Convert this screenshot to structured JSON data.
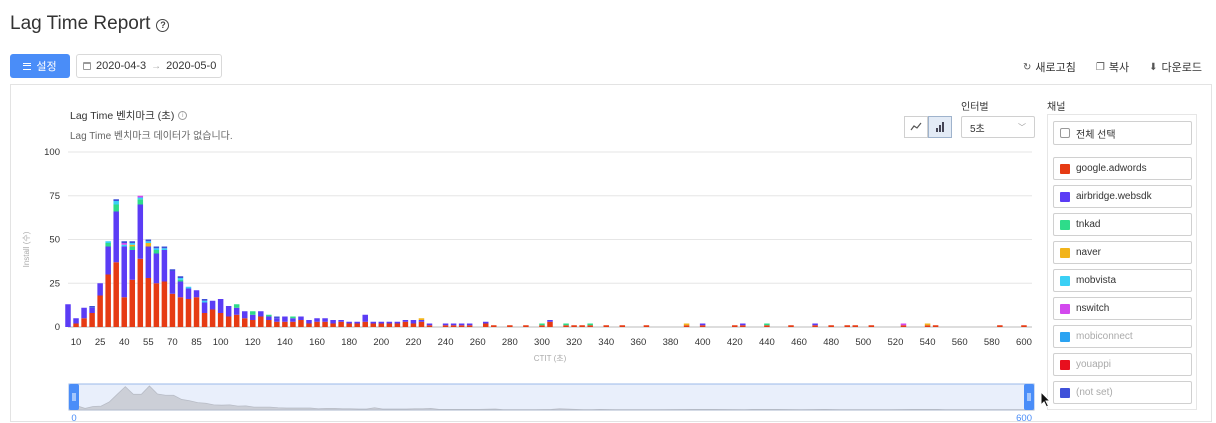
{
  "page": {
    "title": "Lag Time Report"
  },
  "toolbar": {
    "settings_label": "설정",
    "date_start": "2020-04-3",
    "date_end": "2020-05-0",
    "refresh_label": "새로고침",
    "copy_label": "복사",
    "download_label": "다운로드"
  },
  "chart_panel": {
    "title": "Lag Time 벤치마크 (초)",
    "subtitle": "Lag Time 벤치마크 데이터가 없습니다.",
    "interval_label": "인터벌",
    "interval_value": "5초"
  },
  "channels": {
    "label": "채널",
    "select_all": "전체 선택",
    "items": [
      {
        "name": "google.adwords",
        "color": "#e63b14",
        "enabled": true
      },
      {
        "name": "airbridge.websdk",
        "color": "#5b3cf5",
        "enabled": true
      },
      {
        "name": "tnkad",
        "color": "#2edc8a",
        "enabled": true
      },
      {
        "name": "naver",
        "color": "#f2b41b",
        "enabled": true
      },
      {
        "name": "mobvista",
        "color": "#3bd0f5",
        "enabled": true
      },
      {
        "name": "nswitch",
        "color": "#d349ee",
        "enabled": true
      },
      {
        "name": "mobiconnect",
        "color": "#2ba3f2",
        "enabled": false
      },
      {
        "name": "youappi",
        "color": "#e8101e",
        "enabled": false
      },
      {
        "name": "(not set)",
        "color": "#3f51d9",
        "enabled": false
      }
    ]
  },
  "chart_data": {
    "type": "bar",
    "stacked": true,
    "title": "Lag Time 벤치마크 (초)",
    "xlabel": "CTIT (초)",
    "ylabel": "Install (수)",
    "ylim": [
      0,
      100
    ],
    "yticks": [
      0,
      25,
      50,
      75,
      100
    ],
    "xlim": [
      5,
      605
    ],
    "xticks": [
      10,
      25,
      40,
      55,
      70,
      85,
      100,
      120,
      140,
      160,
      180,
      200,
      220,
      240,
      260,
      280,
      300,
      320,
      340,
      360,
      380,
      400,
      420,
      440,
      460,
      480,
      500,
      520,
      540,
      560,
      580,
      600
    ],
    "grid": true,
    "legend": "right",
    "x": [
      5,
      10,
      15,
      20,
      25,
      30,
      35,
      40,
      45,
      50,
      55,
      60,
      65,
      70,
      75,
      80,
      85,
      90,
      95,
      100,
      105,
      110,
      115,
      120,
      125,
      130,
      135,
      140,
      145,
      150,
      155,
      160,
      165,
      170,
      175,
      180,
      185,
      190,
      195,
      200,
      205,
      210,
      215,
      220,
      225,
      230,
      240,
      245,
      250,
      255,
      265,
      270,
      280,
      290,
      300,
      305,
      315,
      320,
      325,
      330,
      340,
      350,
      365,
      390,
      400,
      420,
      425,
      440,
      455,
      470,
      480,
      490,
      495,
      505,
      525,
      540,
      545,
      585,
      600
    ],
    "series": [
      {
        "name": "google.adwords",
        "values": [
          0,
          2,
          5,
          8,
          18,
          30,
          37,
          17,
          27,
          39,
          28,
          25,
          26,
          19,
          17,
          16,
          17,
          8,
          10,
          8,
          6,
          7,
          5,
          4,
          6,
          4,
          3,
          3,
          3,
          4,
          2,
          3,
          3,
          2,
          3,
          2,
          2,
          3,
          2,
          2,
          2,
          2,
          3,
          2,
          3,
          1,
          1,
          1,
          1,
          1,
          2,
          1,
          1,
          1,
          1,
          3,
          1,
          1,
          1,
          1,
          1,
          1,
          1,
          1,
          1,
          1,
          1,
          1,
          1,
          1,
          1,
          1,
          1,
          1,
          1,
          1,
          1,
          1,
          1
        ]
      },
      {
        "name": "airbridge.websdk",
        "values": [
          13,
          3,
          6,
          3,
          7,
          16,
          29,
          29,
          17,
          31,
          18,
          17,
          18,
          13,
          9,
          6,
          4,
          6,
          5,
          8,
          6,
          4,
          4,
          3,
          3,
          2,
          2,
          3,
          2,
          2,
          2,
          2,
          2,
          2,
          1,
          1,
          1,
          4,
          1,
          1,
          1,
          1,
          1,
          2,
          1,
          1,
          1,
          1,
          1,
          1,
          1,
          0,
          0,
          0,
          0,
          1,
          0,
          0,
          0,
          0,
          0,
          0,
          0,
          0,
          1,
          0,
          1,
          0,
          0,
          1,
          0,
          0,
          0,
          0,
          0,
          0,
          0,
          0,
          0
        ]
      },
      {
        "name": "tnkad",
        "values": [
          0,
          0,
          0,
          0,
          0,
          2,
          4,
          0,
          2,
          3,
          0,
          2,
          0,
          0,
          1,
          0,
          0,
          0,
          0,
          0,
          0,
          2,
          0,
          2,
          0,
          1,
          0,
          0,
          1,
          0,
          0,
          0,
          0,
          0,
          0,
          0,
          0,
          0,
          0,
          0,
          0,
          0,
          0,
          0,
          0,
          0,
          0,
          0,
          0,
          0,
          0,
          0,
          0,
          0,
          1,
          0,
          1,
          0,
          0,
          1,
          0,
          0,
          0,
          0,
          0,
          0,
          0,
          1,
          0,
          0,
          0,
          0,
          0,
          0,
          0,
          0,
          0,
          0,
          0
        ]
      },
      {
        "name": "naver",
        "values": [
          0,
          0,
          0,
          0,
          0,
          0,
          0,
          0,
          1,
          0,
          2,
          0,
          0,
          0,
          0,
          0,
          0,
          0,
          0,
          0,
          0,
          0,
          0,
          0,
          0,
          0,
          0,
          0,
          0,
          0,
          0,
          0,
          0,
          0,
          0,
          0,
          0,
          0,
          0,
          0,
          0,
          0,
          0,
          0,
          1,
          0,
          0,
          0,
          0,
          0,
          0,
          0,
          0,
          0,
          0,
          0,
          0,
          0,
          0,
          0,
          0,
          0,
          0,
          1,
          0,
          0,
          0,
          0,
          0,
          0,
          0,
          0,
          0,
          0,
          0,
          1,
          0,
          0,
          0
        ]
      },
      {
        "name": "mobvista",
        "values": [
          0,
          0,
          0,
          0,
          0,
          1,
          2,
          1,
          1,
          1,
          1,
          1,
          1,
          0,
          1,
          1,
          0,
          1,
          0,
          0,
          0,
          0,
          0,
          0,
          0,
          0,
          0,
          0,
          0,
          0,
          0,
          0,
          0,
          0,
          0,
          0,
          0,
          0,
          0,
          0,
          0,
          0,
          0,
          0,
          0,
          0,
          0,
          0,
          0,
          0,
          0,
          0,
          0,
          0,
          0,
          0,
          0,
          0,
          0,
          0,
          0,
          0,
          0,
          0,
          0,
          0,
          0,
          0,
          0,
          0,
          0,
          0,
          0,
          0,
          0,
          0,
          0,
          0,
          0
        ]
      },
      {
        "name": "nswitch",
        "values": [
          0,
          0,
          0,
          0,
          0,
          0,
          0,
          1,
          0,
          1,
          0,
          0,
          0,
          0,
          0,
          0,
          0,
          0,
          0,
          0,
          0,
          0,
          0,
          0,
          0,
          0,
          0,
          0,
          0,
          0,
          0,
          0,
          0,
          0,
          0,
          0,
          0,
          0,
          0,
          0,
          0,
          0,
          0,
          0,
          0,
          0,
          0,
          0,
          0,
          0,
          0,
          0,
          0,
          0,
          0,
          0,
          0,
          0,
          0,
          0,
          0,
          0,
          0,
          0,
          0,
          0,
          0,
          0,
          0,
          0,
          0,
          0,
          0,
          0,
          1,
          0,
          0,
          0,
          0
        ]
      },
      {
        "name": "(not set)",
        "values": [
          0,
          0,
          0,
          1,
          0,
          0,
          1,
          1,
          1,
          0,
          1,
          1,
          1,
          1,
          1,
          0,
          0,
          1,
          0,
          0,
          0,
          0,
          0,
          0,
          0,
          0,
          1,
          0,
          0,
          0,
          0,
          0,
          0,
          0,
          0,
          0,
          0,
          0,
          0,
          0,
          0,
          0,
          0,
          0,
          0,
          0,
          0,
          0,
          0,
          0,
          0,
          0,
          0,
          0,
          0,
          0,
          0,
          0,
          0,
          0,
          0,
          0,
          0,
          0,
          0,
          0,
          0,
          0,
          0,
          0,
          0,
          0,
          0,
          0,
          0,
          0,
          0,
          0,
          0
        ]
      }
    ],
    "range_slider": {
      "min_label": "0",
      "max_label": "600",
      "min": 0,
      "max": 600
    }
  }
}
